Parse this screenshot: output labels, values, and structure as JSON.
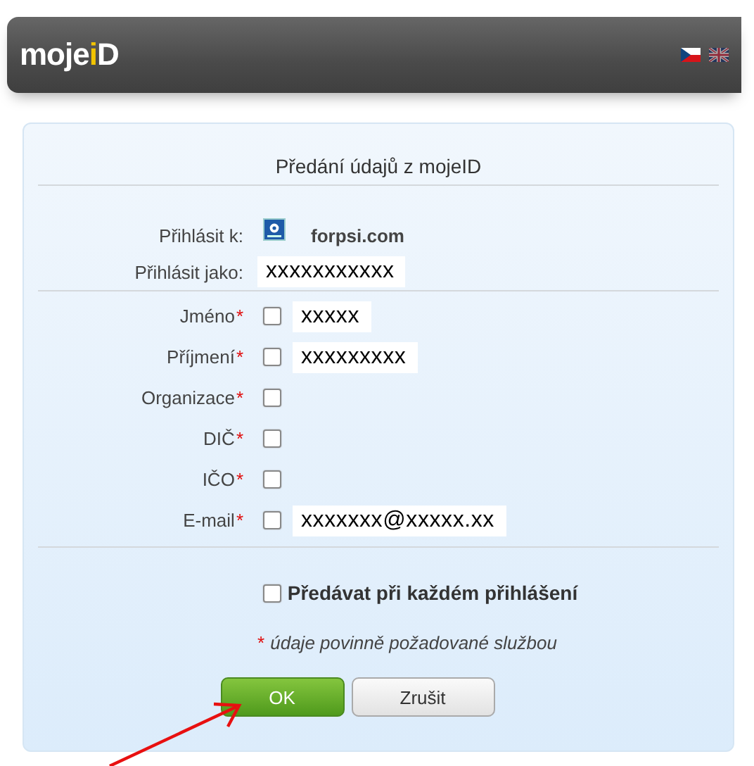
{
  "header": {
    "logo": {
      "prefix": "moje",
      "accent": "i",
      "suffix": "D"
    },
    "languages": [
      {
        "kind": "cz",
        "selected": true
      },
      {
        "kind": "uk",
        "selected": false
      }
    ]
  },
  "dialog": {
    "title": "Předání údajů z mojeID",
    "login": {
      "site_label": "Přihlásit k:",
      "site_name": "forpsi.com",
      "user_label": "Přihlásit jako:",
      "user_value": "xxxxxxxxxxx"
    },
    "fields": [
      {
        "label": "Jméno",
        "mark": "*",
        "checked": false,
        "value": "xxxxx"
      },
      {
        "label": "Příjmení",
        "mark": "*",
        "checked": false,
        "value": "xxxxxxxxx"
      },
      {
        "label": "Organizace",
        "mark": "*",
        "checked": false
      },
      {
        "label": "DIČ",
        "mark": "*",
        "checked": false
      },
      {
        "label": "IČO",
        "mark": "*",
        "checked": false
      },
      {
        "label": "E-mail",
        "mark": "*",
        "checked": false,
        "value": "xxxxxxx@xxxxx.xx"
      }
    ],
    "remember": {
      "label": "Předávat při každém přihlášení",
      "checked": false
    },
    "note": {
      "mark": "*",
      "text": "údaje povinně požadované službou"
    },
    "buttons": [
      {
        "label": "OK",
        "kind": "primary"
      },
      {
        "label": "Zrušit",
        "kind": "secondary"
      }
    ]
  }
}
